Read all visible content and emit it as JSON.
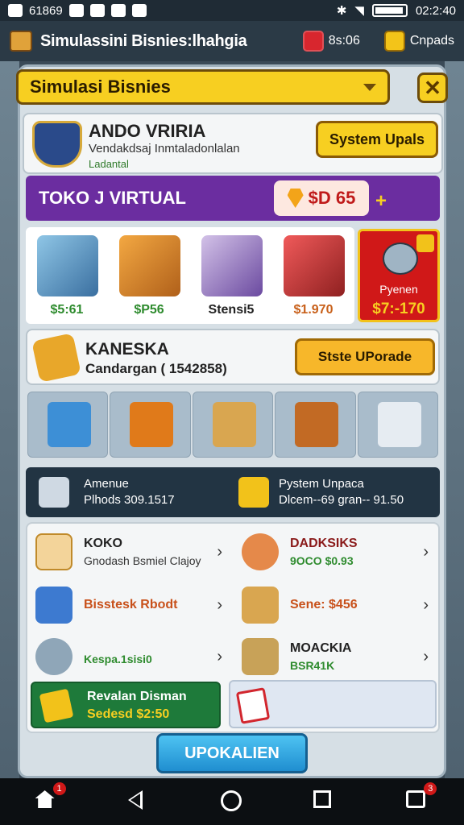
{
  "status_bar": {
    "left_text": "61869",
    "time": "02:2:40"
  },
  "app_bar": {
    "title": "Simulassini Bisnies:lhahgia",
    "gems_value": "8s:06",
    "coins_value": "Cnpads"
  },
  "dropdown": {
    "label": "Simulasi Bisnies"
  },
  "profile": {
    "name": "ANDO VRIRIA",
    "subtitle": "Vendakdsaj Inmtaladonlalan",
    "tag": "Ladantal",
    "system_button": "System Upals"
  },
  "shop": {
    "title": "TOKO J VIRTUAL",
    "price": "$D 65",
    "plus": "+"
  },
  "items": [
    {
      "label": "$5:61",
      "color": "#2e8b2e"
    },
    {
      "label": "$P56",
      "color": "#2e8b2e"
    },
    {
      "label": "Stensi5",
      "color": "#222222"
    },
    {
      "label": "$1.970",
      "color": "#c8601a"
    }
  ],
  "special_offer": {
    "title": "Pyenen",
    "price": "$7:-170"
  },
  "kaneska": {
    "title": "KANESKA",
    "subtitle": "Candargan ( 1542858)",
    "button": "Stste UPorade"
  },
  "info_bar": {
    "left_title": "Amenue",
    "left_value": "Plhods 309.1517",
    "right_title": "Pystem Unpaca",
    "right_value": "Dlcem--69 gran-- 91.50"
  },
  "list_items": [
    {
      "title": "KOKO",
      "subtitle": "Gnodash Bsmiel Clajoy",
      "title_color": "#222222",
      "sub_color": "#333333"
    },
    {
      "title": "DADKSIKS",
      "subtitle": "9OCO $0.93",
      "title_color": "#8a1a1a",
      "sub_color": "#2e8b2e"
    },
    {
      "title": "Bisstesk Rbodt",
      "subtitle": "",
      "title_color": "#c8501a",
      "sub_color": "#333333"
    },
    {
      "title": "Sene: $456",
      "subtitle": "",
      "title_color": "#c8501a",
      "sub_color": "#333333"
    },
    {
      "title": "",
      "subtitle": "Kespa.1sisi0",
      "title_color": "#222222",
      "sub_color": "#2e8b2e"
    },
    {
      "title": "MOACKIA",
      "subtitle": "BSR41K",
      "title_color": "#222222",
      "sub_color": "#2e8b2e"
    }
  ],
  "revalan": {
    "title": "Revalan Disman",
    "value": "Sedesd $2:50"
  },
  "main_button": "UPOKALIEN",
  "nav": {
    "home_badge": "1",
    "recents_badge": "3"
  }
}
